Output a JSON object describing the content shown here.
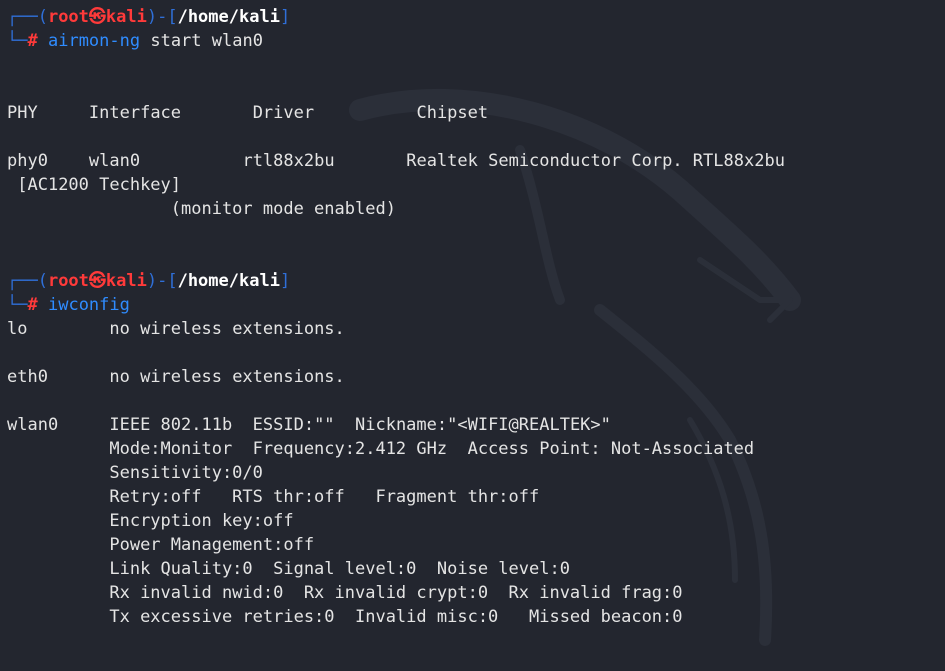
{
  "colors": {
    "background": "#23262f",
    "prompt_frame": "#2f6fd8",
    "prompt_user": "#ff3a3a",
    "prompt_path": "#ffffff",
    "command": "#2f8cff",
    "text": "#e4e4e4"
  },
  "prompts": [
    {
      "user": "root",
      "symbol": "㉿",
      "host": "kali",
      "path": "/home/kali",
      "marker": "#",
      "command": "airmon-ng",
      "args": " start wlan0"
    },
    {
      "user": "root",
      "symbol": "㉿",
      "host": "kali",
      "path": "/home/kali",
      "marker": "#",
      "command": "iwconfig",
      "args": ""
    }
  ],
  "airmon": {
    "headers": [
      "PHY",
      "Interface",
      "Driver",
      "Chipset"
    ],
    "row": {
      "phy": "phy0",
      "interface": "wlan0",
      "driver": "rtl88x2bu",
      "chipset": "Realtek Semiconductor Corp. RTL88x2bu",
      "chipset_cont": "[AC1200 Techkey]"
    },
    "note": "(monitor mode enabled)"
  },
  "iwconfig": {
    "lo": {
      "name": "lo",
      "info": "no wireless extensions."
    },
    "eth0": {
      "name": "eth0",
      "info": "no wireless extensions."
    },
    "wlan0": {
      "name": "wlan0",
      "lines": [
        "IEEE 802.11b  ESSID:\"\"  Nickname:\"<WIFI@REALTEK>\"",
        "Mode:Monitor  Frequency:2.412 GHz  Access Point: Not-Associated",
        "Sensitivity:0/0",
        "Retry:off   RTS thr:off   Fragment thr:off",
        "Encryption key:off",
        "Power Management:off",
        "Link Quality:0  Signal level:0  Noise level:0",
        "Rx invalid nwid:0  Rx invalid crypt:0  Rx invalid frag:0",
        "Tx excessive retries:0  Invalid misc:0   Missed beacon:0"
      ]
    }
  }
}
